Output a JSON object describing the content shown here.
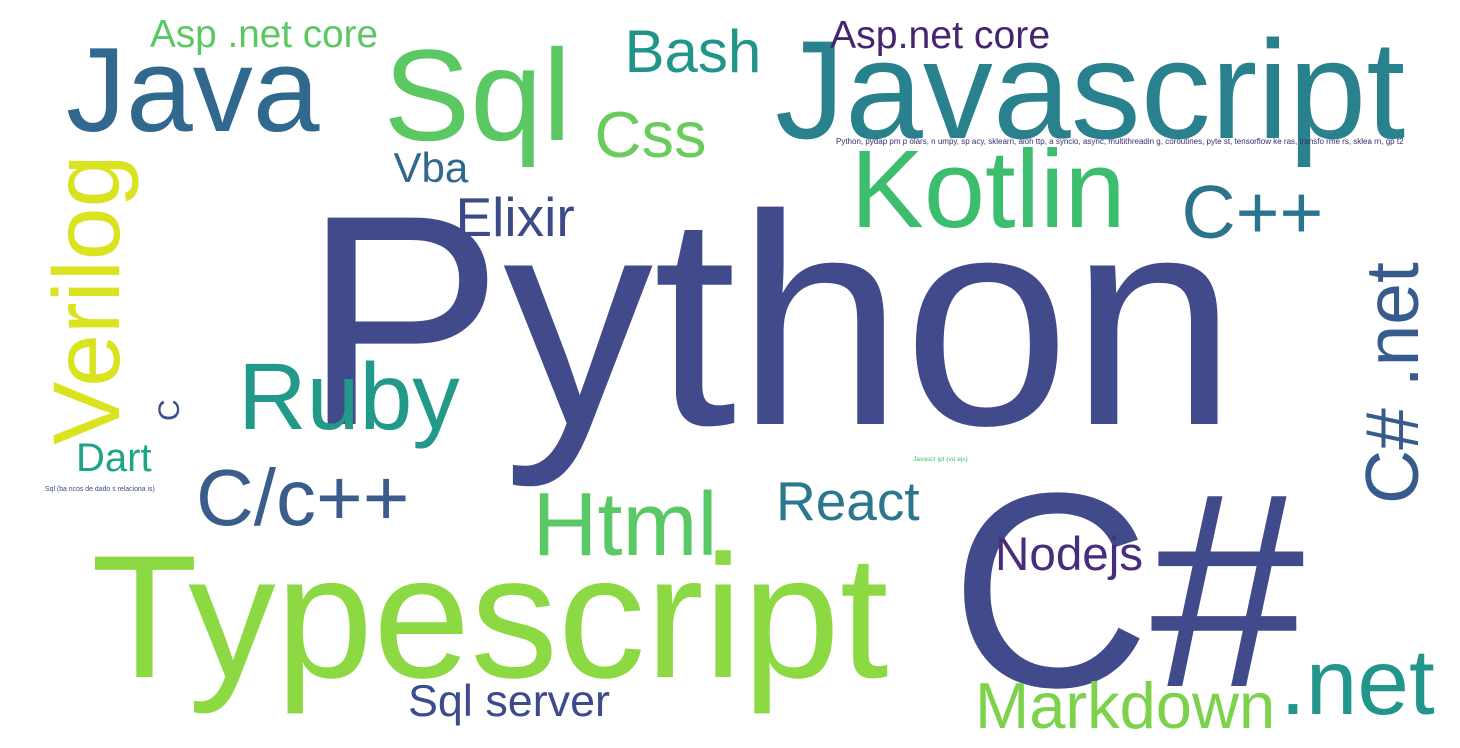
{
  "words": [
    {
      "text": "Python",
      "color": "#414a8b",
      "rotated": false
    },
    {
      "text": "C#",
      "color": "#414a8b",
      "rotated": false
    },
    {
      "text": "Typescript",
      "color": "#8cd943",
      "rotated": false
    },
    {
      "text": "Javascript",
      "color": "#2a818e",
      "rotated": false
    },
    {
      "text": "Java",
      "color": "#31688e",
      "rotated": false
    },
    {
      "text": "Sql",
      "color": "#5cc863",
      "rotated": false
    },
    {
      "text": "Kotlin",
      "color": "#3dbd6e",
      "rotated": false
    },
    {
      "text": "Ruby",
      "color": "#239a89",
      "rotated": false
    },
    {
      "text": "C/c++",
      "color": "#3b5d8c",
      "rotated": false
    },
    {
      "text": "Html",
      "color": "#5ac864",
      "rotated": false
    },
    {
      "text": "C# .net",
      "color": "#365b8c",
      "rotated": true
    },
    {
      "text": "Verilog",
      "color": "#dae31f",
      "rotated": true
    },
    {
      "text": ".net",
      "color": "#22968b",
      "rotated": false
    },
    {
      "text": "Markdown",
      "color": "#7dd24c",
      "rotated": false
    },
    {
      "text": "C++",
      "color": "#2b748e",
      "rotated": false
    },
    {
      "text": "Css",
      "color": "#69cd5b",
      "rotated": false
    },
    {
      "text": "Bash",
      "color": "#22958b",
      "rotated": false
    },
    {
      "text": "React",
      "color": "#2b788e",
      "rotated": false
    },
    {
      "text": "Elixir",
      "color": "#3d4a89",
      "rotated": false
    },
    {
      "text": "Sql server",
      "color": "#3b4b8b",
      "rotated": false
    },
    {
      "text": "Nodejs",
      "color": "#472d7b",
      "rotated": false
    },
    {
      "text": "Asp .net core",
      "color": "#5cc863",
      "rotated": false
    },
    {
      "text": "Asp.net core",
      "color": "#46256f",
      "rotated": false
    },
    {
      "text": "Vba",
      "color": "#31688e",
      "rotated": false
    },
    {
      "text": "Dart",
      "color": "#20a486",
      "rotated": false
    },
    {
      "text": "C",
      "color": "#3d4e8a",
      "rotated": true
    },
    {
      "text": "Python, pydap pm p olars, n umpy, sp acy, sklearn, aioh ttp, a syncio, async, multithreadin g, coroutines, pyte st, tensorflow ke ras, transfo rme rs, sklea rn, gp t2",
      "color": "#3a2c6e",
      "rotated": false
    },
    {
      "text": "Javascr ipt (vu ejs)",
      "color": "#3dbd6e",
      "rotated": false
    },
    {
      "text": "Sql (ba ncos de dado s relaciona is)",
      "color": "#3b4b8b",
      "rotated": false
    }
  ]
}
